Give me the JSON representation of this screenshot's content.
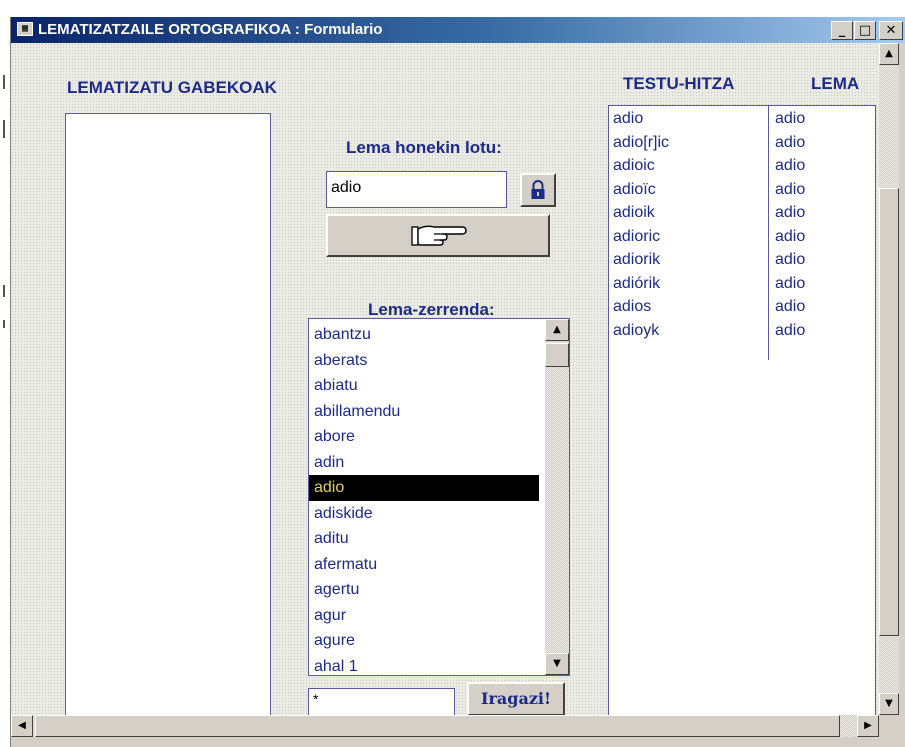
{
  "window": {
    "title": "LEMATIZATZAILE ORTOGRAFIKOA : Formulario",
    "title_icon": "form-icon",
    "controls": {
      "minimize": "_",
      "restore": "□",
      "close": "✕"
    }
  },
  "left_panel": {
    "label": "LEMATIZATU GABEKOAK",
    "items": []
  },
  "middle": {
    "link_label": "Lema honekin lotu:",
    "lema_value": "adio",
    "lock_icon": "lock-icon",
    "assign_icon": "pointing-hand-icon",
    "list_label": "Lema-zerrenda:",
    "lemas": [
      "abantzu",
      "aberats",
      "abiatu",
      "abillamendu",
      "abore",
      "adin",
      "adio",
      "adiskide",
      "aditu",
      "afermatu",
      "agertu",
      "agur",
      "agure",
      "ahal 1"
    ],
    "selected_lema": "adio",
    "filter_value": "*",
    "filter_button": "Iragazi!"
  },
  "right_panel": {
    "headers": {
      "text_word": "TESTU-HITZA",
      "lemma": "LEMA"
    },
    "rows": [
      {
        "word": "adio",
        "lemma": "adio"
      },
      {
        "word": "adio[r]ic",
        "lemma": "adio"
      },
      {
        "word": "adioic",
        "lemma": "adio"
      },
      {
        "word": "adioïc",
        "lemma": "adio"
      },
      {
        "word": "adioik",
        "lemma": "adio"
      },
      {
        "word": "adioric",
        "lemma": "adio"
      },
      {
        "word": "adiorik",
        "lemma": "adio"
      },
      {
        "word": "adiórik",
        "lemma": "adio"
      },
      {
        "word": "adios",
        "lemma": "adio"
      },
      {
        "word": "adioyk",
        "lemma": "adio"
      }
    ]
  },
  "colors": {
    "title_bar": "#0a246a",
    "label_text": "#1c2a8a",
    "selection": "#000000"
  }
}
